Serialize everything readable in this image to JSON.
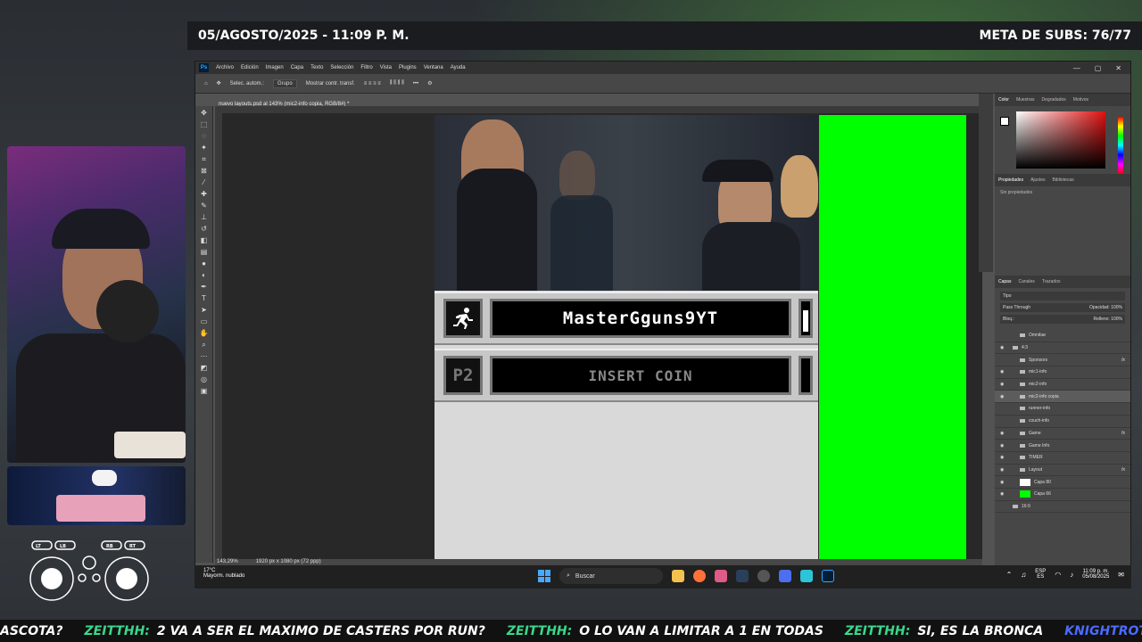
{
  "overlay": {
    "datetime": "05/AGOSTO/2025 - 11:09 P. M.",
    "sub_goal": "META DE SUBS: 76/77",
    "ticker": [
      {
        "text": "ASCOTA?",
        "color": "white"
      },
      {
        "text": "ZEITTHH:",
        "color": "green"
      },
      {
        "text": "2 VA A SER EL MAXIMO DE CASTERS POR RUN?",
        "color": "white"
      },
      {
        "text": "ZEITTHH:",
        "color": "green"
      },
      {
        "text": "O LO VAN A LIMITAR A 1 EN TODAS",
        "color": "white"
      },
      {
        "text": "ZEITTHH:",
        "color": "green"
      },
      {
        "text": "SI, ES LA BRONCA",
        "color": "white"
      },
      {
        "text": "KNIGHTROTCE:",
        "color": "blue"
      }
    ],
    "controller_labels": {
      "lt": "LT",
      "lb": "LB",
      "rb": "RB",
      "rt": "RT"
    }
  },
  "photoshop": {
    "logo": "Ps",
    "menu": [
      "Archivo",
      "Edición",
      "Imagen",
      "Capa",
      "Texto",
      "Selección",
      "Filtro",
      "Vista",
      "Plugins",
      "Ventana",
      "Ayuda"
    ],
    "options": {
      "auto_select": "Selec. autom.:",
      "group": "Grupo",
      "transform": "Mostrar contr. transf."
    },
    "doc_tab": "nuevo layouts.psd al 143% (mic2-info copia, RGB/8#) *",
    "status": {
      "zoom": "143,29%",
      "size": "1920 px x 1080 px (72 ppp)"
    },
    "canvas": {
      "p1_name": "MasterGguns9YT",
      "p2_label": "P2",
      "p2_name": "INSERT COIN"
    },
    "panels": {
      "color_tabs": [
        "Color",
        "Muestras",
        "Degradados",
        "Motivos"
      ],
      "props_tabs": [
        "Propiedades",
        "Ajustes",
        "Bibliotecas"
      ],
      "props_text": "Sin propiedades",
      "layers_tabs": [
        "Capas",
        "Canales",
        "Trazados"
      ],
      "filter": "Tipo",
      "blend": "Pass Through",
      "opacity": "Opacidad: 100%",
      "fill": "Relleno: 100%",
      "lock": "Bloq.:"
    },
    "layers": [
      {
        "name": "Omnibar",
        "eye": false,
        "fx": false,
        "indent": 1
      },
      {
        "name": "4:3",
        "eye": true,
        "fx": false,
        "indent": 0
      },
      {
        "name": "Sponsors",
        "eye": false,
        "fx": true,
        "indent": 1
      },
      {
        "name": "mic1-info",
        "eye": true,
        "fx": false,
        "indent": 1
      },
      {
        "name": "mic2-info",
        "eye": true,
        "fx": false,
        "indent": 1
      },
      {
        "name": "mic2-info copia",
        "eye": true,
        "fx": false,
        "indent": 1,
        "selected": true
      },
      {
        "name": "runner-info",
        "eye": false,
        "fx": false,
        "indent": 1
      },
      {
        "name": "couch-info",
        "eye": false,
        "fx": false,
        "indent": 1
      },
      {
        "name": "Game",
        "eye": true,
        "fx": true,
        "indent": 1
      },
      {
        "name": "Game Info",
        "eye": true,
        "fx": false,
        "indent": 1
      },
      {
        "name": "TIMER",
        "eye": true,
        "fx": false,
        "indent": 1
      },
      {
        "name": "Layout",
        "eye": true,
        "fx": true,
        "indent": 1
      },
      {
        "name": "Capa 80",
        "eye": true,
        "fx": false,
        "indent": 1,
        "thumb": "white"
      },
      {
        "name": "Capa 66",
        "eye": true,
        "fx": false,
        "indent": 1,
        "thumb": "green"
      },
      {
        "name": "16:9",
        "eye": false,
        "fx": false,
        "indent": 0
      }
    ]
  },
  "taskbar": {
    "weather_temp": "17°C",
    "weather_desc": "Mayorm. nublado",
    "search": "Buscar",
    "lang_1": "ESP",
    "lang_2": "ES",
    "time": "11:09 p. m.",
    "date": "05/08/2025"
  }
}
